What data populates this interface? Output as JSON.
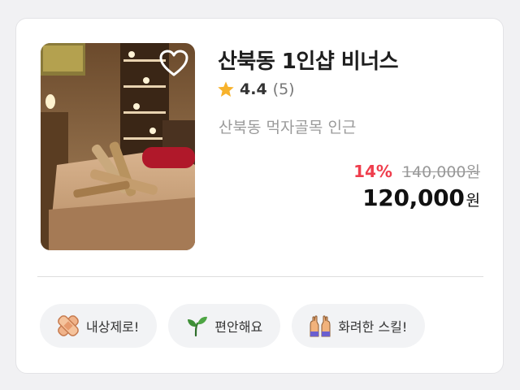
{
  "listing": {
    "title": "산북동 1인샵 비너스",
    "rating": "4.4",
    "review_count": "(5)",
    "location": "산북동 먹자골목 인근",
    "discount": "14%",
    "original_price": "140,000원",
    "price": "120,000",
    "currency": "원",
    "favorite_icon": "heart-outline-icon",
    "rating_icon": "star-icon",
    "accent_color": "#ef3e4d",
    "star_color": "#f7b22b"
  },
  "tags": [
    {
      "label": "내상제로!",
      "icon": "bandage-icon"
    },
    {
      "label": "편안해요",
      "icon": "sprout-icon"
    },
    {
      "label": "화려한 스킬!",
      "icon": "raised-hands-icon"
    }
  ]
}
